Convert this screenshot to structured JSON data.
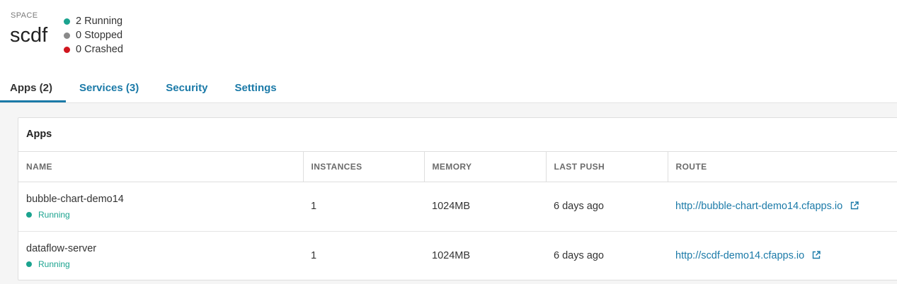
{
  "space": {
    "label": "SPACE",
    "name": "scdf",
    "statuses": [
      {
        "text": "2 Running",
        "color": "#1ba38f"
      },
      {
        "text": "0 Stopped",
        "color": "#8a8a8a"
      },
      {
        "text": "0 Crashed",
        "color": "#d0161e"
      }
    ]
  },
  "tabs": [
    {
      "label": "Apps (2)",
      "active": true
    },
    {
      "label": "Services (3)",
      "active": false
    },
    {
      "label": "Security",
      "active": false
    },
    {
      "label": "Settings",
      "active": false
    }
  ],
  "apps_panel": {
    "title": "Apps",
    "columns": [
      "NAME",
      "INSTANCES",
      "MEMORY",
      "LAST PUSH",
      "ROUTE"
    ],
    "rows": [
      {
        "name": "bubble-chart-demo14",
        "status": "Running",
        "instances": "1",
        "memory": "1024MB",
        "last_push": "6 days ago",
        "route": "http://bubble-chart-demo14.cfapps.io",
        "route_icon": "external-link-icon"
      },
      {
        "name": "dataflow-server",
        "status": "Running",
        "instances": "1",
        "memory": "1024MB",
        "last_push": "6 days ago",
        "route": "http://scdf-demo14.cfapps.io",
        "route_icon": "external-link-icon"
      }
    ]
  },
  "colors": {
    "accent": "#1b7aa8",
    "running": "#1ba38f"
  }
}
